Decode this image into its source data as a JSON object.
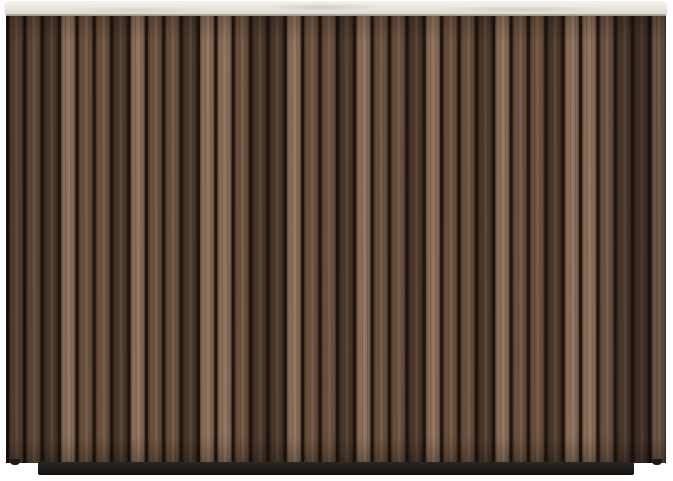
{
  "image": {
    "subject": "",
    "colors": {
      "background": "#ffffff",
      "wood_dark": "#4a3628",
      "wood_mid": "#6b4f3c",
      "wood_light": "#8b6d57",
      "groove": "#1e1510",
      "marble": "#ebe8e2",
      "plinth": "#1c1916"
    },
    "slat_count": 38
  }
}
